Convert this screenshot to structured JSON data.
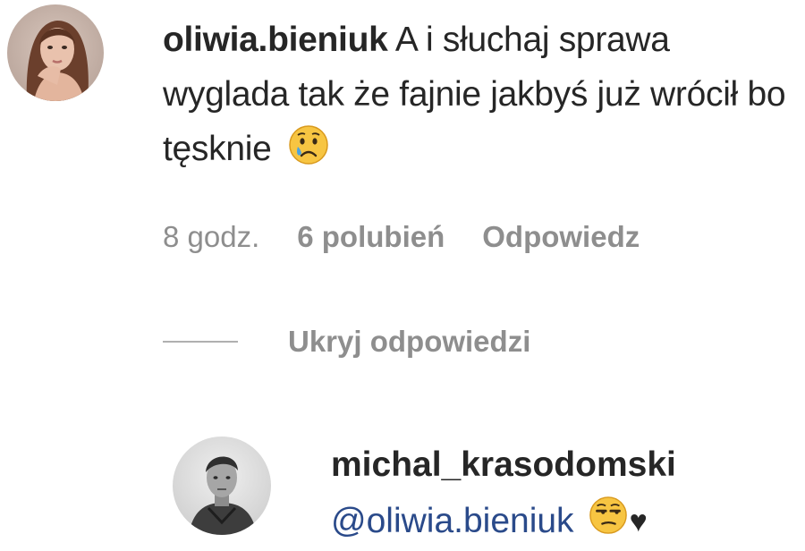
{
  "comment": {
    "username": "oliwia.bieniuk",
    "text": "A i słuchaj sprawa wyglada tak że fajnie jakbyś już wrócił bo tęsknie",
    "emoji_icon": "crying-face-icon",
    "time": "8 godz.",
    "likes": "6 polubień",
    "reply_label": "Odpowiedz"
  },
  "replies_toggle": {
    "label": "Ukryj odpowiedzi"
  },
  "reply": {
    "username": "michal_krasodomski",
    "mention": "@oliwia.bieniuk",
    "emoji_icon": "unamused-face-icon",
    "heart": "♥"
  }
}
